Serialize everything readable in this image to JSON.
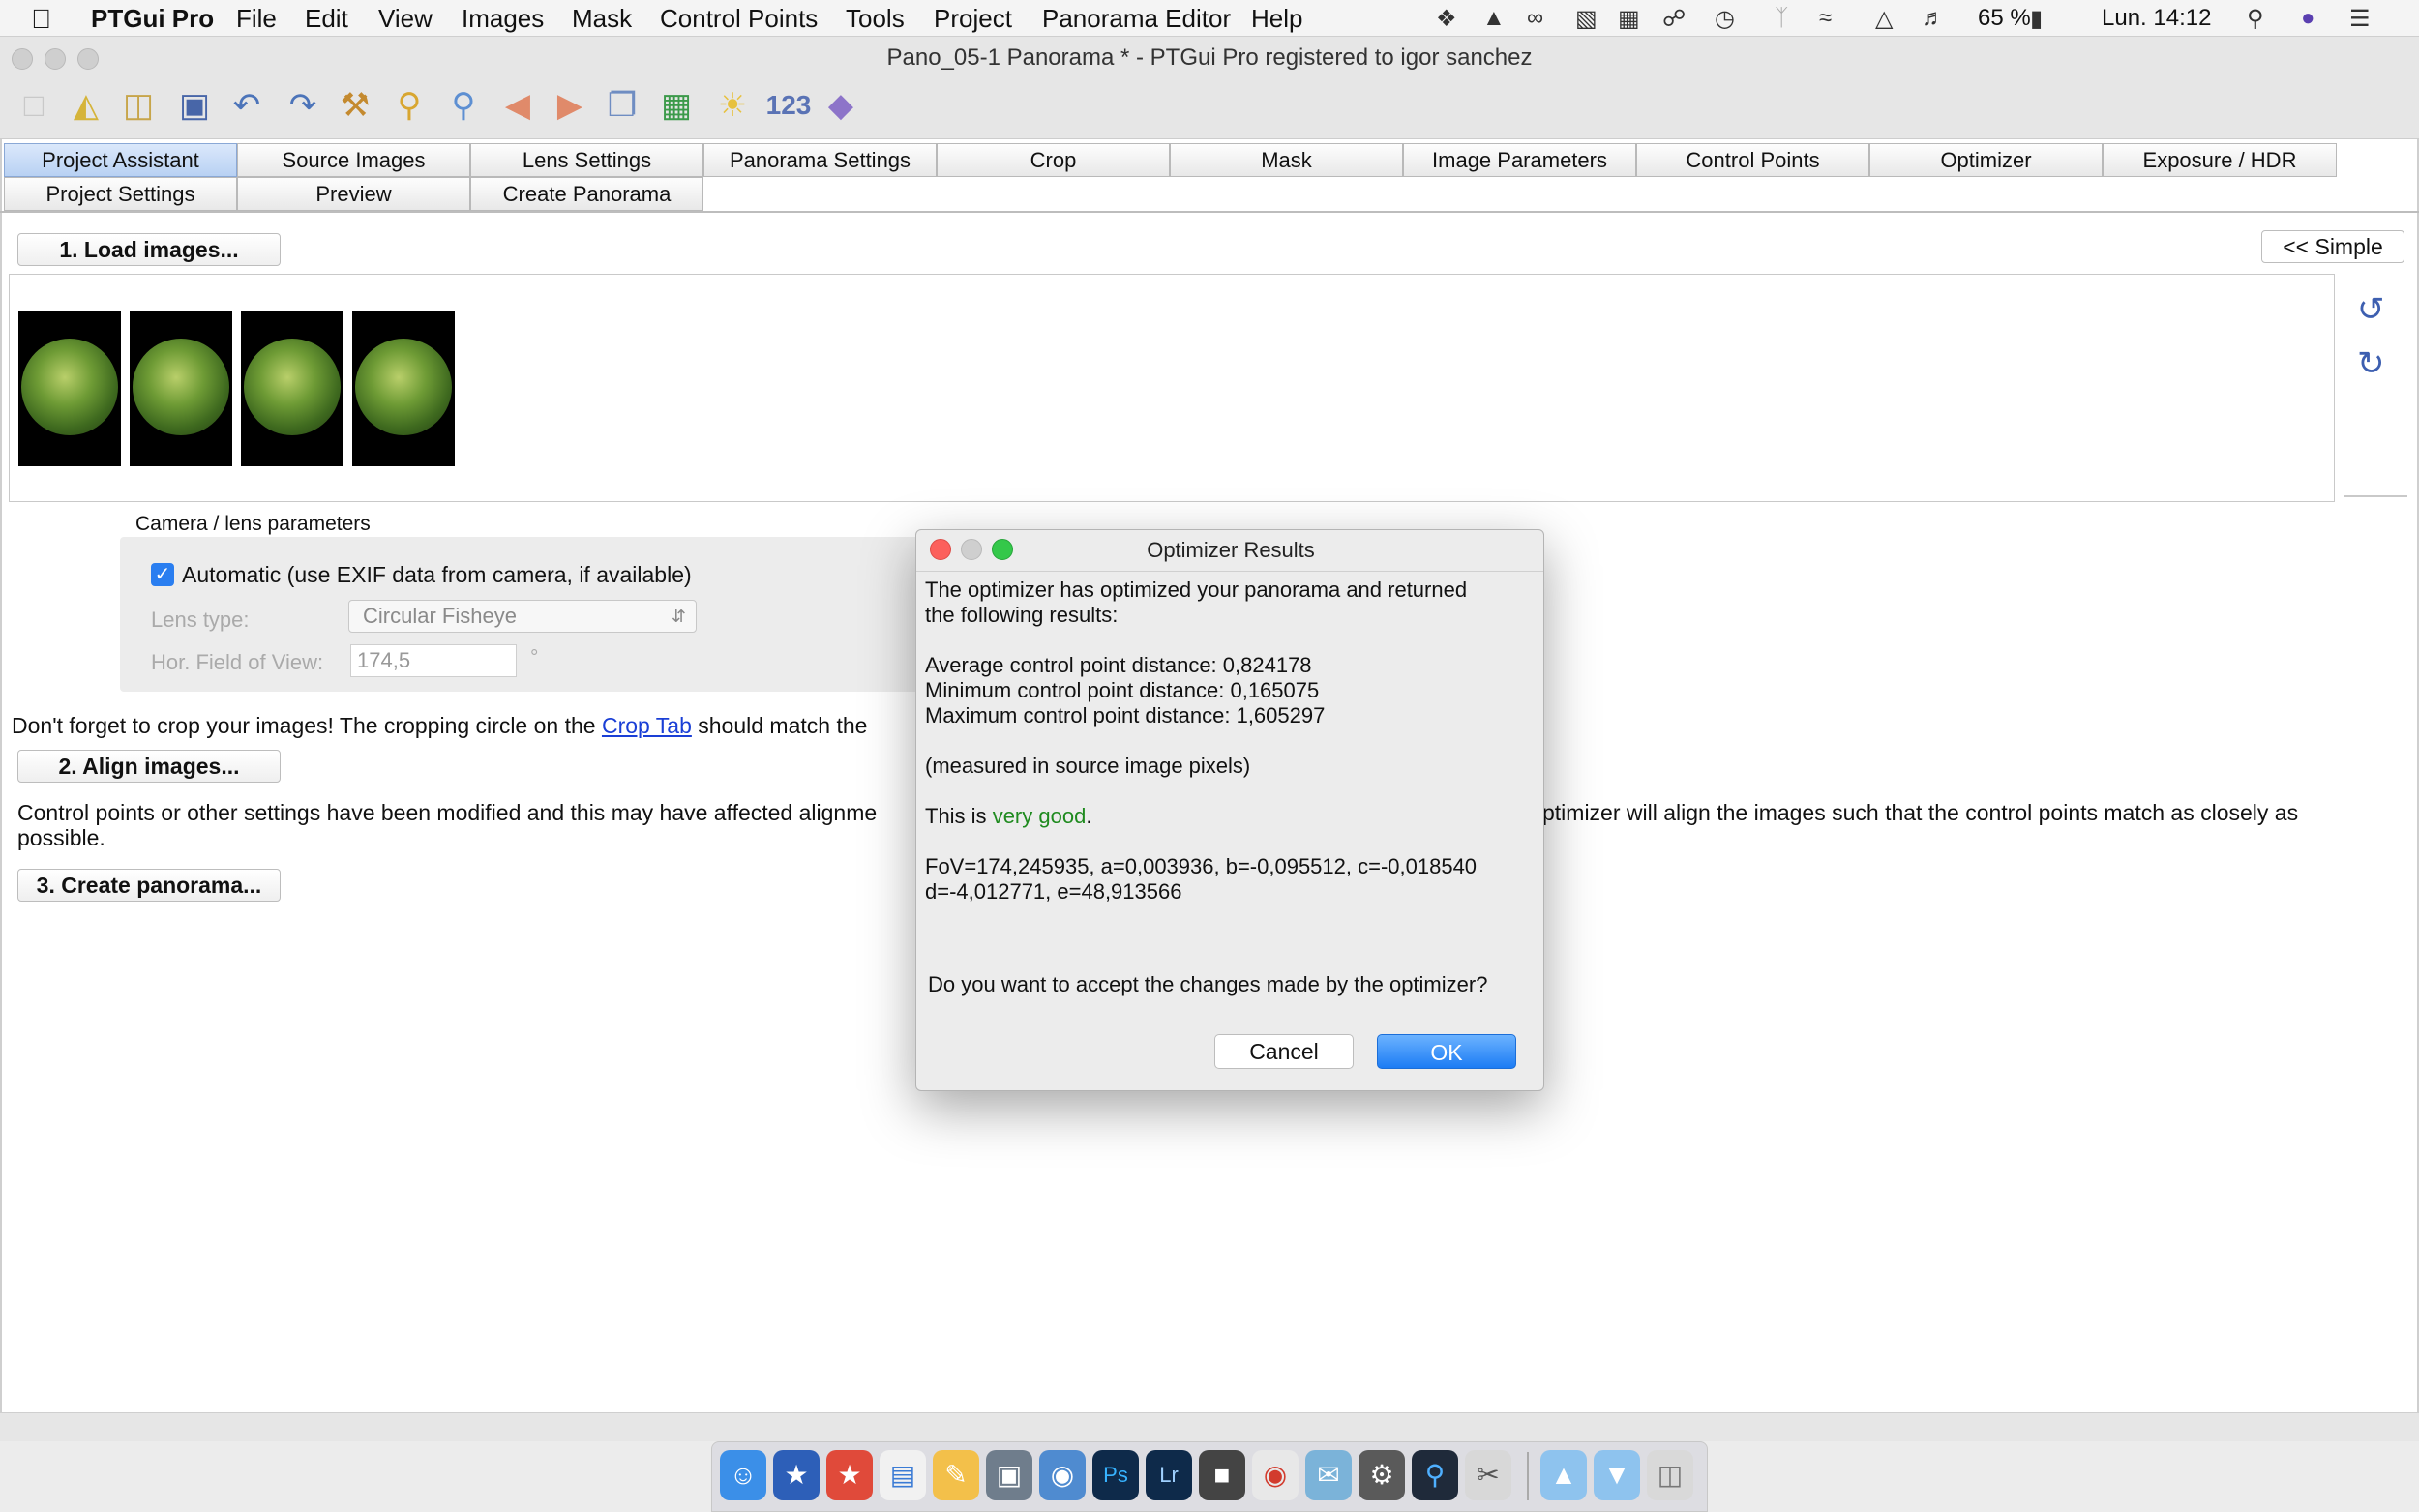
{
  "menubar": {
    "app_name": "PTGui Pro",
    "items": [
      "File",
      "Edit",
      "View",
      "Images",
      "Mask",
      "Control Points",
      "Tools",
      "Project",
      "Panorama Editor",
      "Help"
    ],
    "battery": "65 %",
    "clock": "Lun. 14:12"
  },
  "window": {
    "title": "Pano_05-1 Panorama * - PTGui Pro registered to igor sanchez"
  },
  "toolbar": {
    "counter_label": "123"
  },
  "tabs": {
    "row1": [
      "Project Assistant",
      "Source Images",
      "Lens Settings",
      "Panorama Settings",
      "Crop",
      "Mask",
      "Image Parameters",
      "Control Points",
      "Optimizer",
      "Exposure / HDR"
    ],
    "row2": [
      "Project Settings",
      "Preview",
      "Create Panorama"
    ]
  },
  "assistant": {
    "load_button": "1. Load images...",
    "simple_button": "<< Simple",
    "camera_group_label": "Camera / lens parameters",
    "automatic_label": "Automatic (use EXIF data from camera, if available)",
    "lens_type_label": "Lens type:",
    "lens_type_value": "Circular Fisheye",
    "hfov_label": "Hor. Field of View:",
    "hfov_value": "174,5",
    "degree": "°",
    "crop_text_before": "Don't forget to crop your images! The cropping circle on the",
    "crop_link": "Crop Tab",
    "crop_text_after": "should match the",
    "align_button": "2. Align images...",
    "align_text_left": "Control points or other settings have been modified and this may have affected alignme",
    "align_text_right": "ptimizer will align the images such that the control points match as closely as",
    "align_text_line2": "possible.",
    "create_button": "3. Create panorama..."
  },
  "dialog": {
    "title": "Optimizer Results",
    "intro_line1": "The optimizer has optimized your panorama and returned",
    "intro_line2": "the following results:",
    "avg": "Average control point distance: 0,824178",
    "min": "Minimum control point distance: 0,165075",
    "max": "Maximum control point distance: 1,605297",
    "measured": "(measured in source image pixels)",
    "verdict_prefix": "This is ",
    "verdict": "very good",
    "verdict_suffix": ".",
    "params_line1": "FoV=174,245935, a=0,003936, b=-0,095512, c=-0,018540",
    "params_line2": "d=-4,012771, e=48,913566",
    "question": "Do you want to accept the changes made by the optimizer?",
    "cancel_label": "Cancel",
    "ok_label": "OK"
  },
  "colors": {
    "accent": "#1c7cf4",
    "good": "#1e8a1e",
    "link": "#1a3fd6"
  }
}
